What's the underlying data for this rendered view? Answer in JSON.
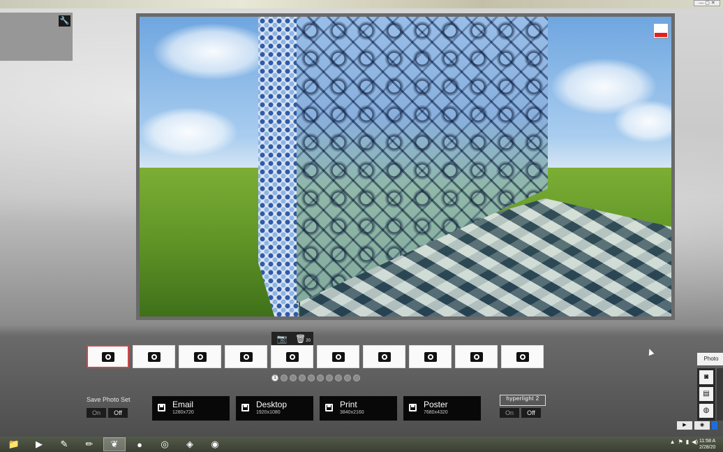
{
  "window": {
    "controls_label": "— ▢ ✕"
  },
  "toolbar": {
    "wrench_icon": "wrench-icon",
    "wrench_glyph": "🔧"
  },
  "camera_tools": {
    "camera_glyph": "📷",
    "trash_glyph": "🗑",
    "trash_sub": "20"
  },
  "photo_slots": [
    {
      "active": true
    },
    {
      "active": false
    },
    {
      "active": false
    },
    {
      "active": false
    },
    {
      "active": false
    },
    {
      "active": false
    },
    {
      "active": false
    },
    {
      "active": false
    },
    {
      "active": false
    },
    {
      "active": false
    }
  ],
  "pager": {
    "pages": [
      "1",
      "2",
      "3",
      "4",
      "5",
      "6",
      "7",
      "8",
      "9",
      "10"
    ],
    "current_label": "1"
  },
  "save_photo_set": {
    "label": "Save Photo Set",
    "on_label": "On",
    "off_label": "Off"
  },
  "export_buttons": [
    {
      "name": "Email",
      "size": "1280x720"
    },
    {
      "name": "Desktop",
      "size": "1920x1080"
    },
    {
      "name": "Print",
      "size": "3840x2160"
    },
    {
      "name": "Poster",
      "size": "7680x4320"
    }
  ],
  "hyperlight": {
    "label": "hyperlight 2",
    "on_label": "On",
    "off_label": "Off"
  },
  "side_panel": {
    "photo_tab": "Photo",
    "icons": [
      "camera-icon",
      "film-icon",
      "globe-icon"
    ]
  },
  "playback": {
    "play": "▶",
    "stop": "◉"
  },
  "taskbar": {
    "items": [
      "📁",
      "▶",
      "✎",
      "✏",
      "❦",
      "●",
      "◎",
      "◈",
      "◉"
    ],
    "clock_time": "11:58 A",
    "clock_date": "2/28/20"
  },
  "colors": {
    "accent_red": "#c9484c",
    "record_red": "#e02020",
    "blue": "#1d6fd8"
  }
}
